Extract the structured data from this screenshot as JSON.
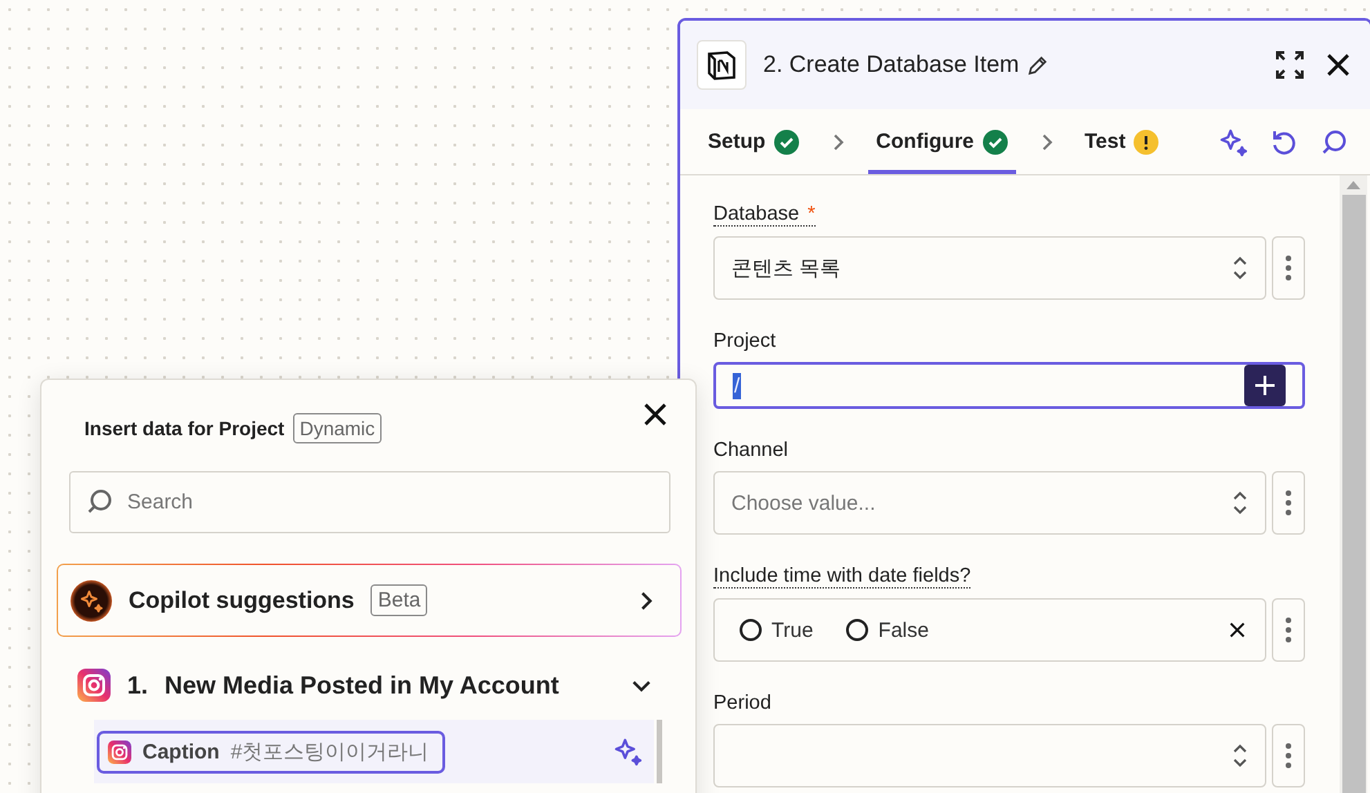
{
  "panel": {
    "title": "2. Create Database Item",
    "tabs": [
      {
        "label": "Setup",
        "selected": false,
        "complete": true
      },
      {
        "label": "Configure",
        "selected": true,
        "complete": true
      },
      {
        "label": "Test",
        "selected": false,
        "complete": false
      }
    ],
    "fields": [
      {
        "kind": "select",
        "label": "Database",
        "required_mark": "*",
        "hint": true,
        "value": "콘텐츠 목록"
      },
      {
        "kind": "input",
        "label": "Project",
        "hint": false,
        "value": "/",
        "focused": true
      },
      {
        "kind": "select",
        "label": "Channel",
        "hint": false,
        "placeholder": "Choose value..."
      },
      {
        "kind": "radio",
        "label": "Include time with date fields?",
        "hint": true,
        "options": [
          {
            "label": "True",
            "checked": false
          },
          {
            "label": "False",
            "checked": false
          }
        ]
      },
      {
        "kind": "select",
        "label": "Period",
        "hint": false
      }
    ]
  },
  "popup": {
    "title": "Insert data for Project",
    "badge": "Dynamic",
    "search": {
      "placeholder": "Search"
    },
    "copilot": {
      "label": "Copilot suggestions",
      "badge": "Beta"
    },
    "steps": [
      {
        "number": "1.",
        "title": "New Media Posted in My Account",
        "expanded": true,
        "items": [
          {
            "label": "Caption",
            "value": "#첫포스팅이이거라니",
            "selected": true
          }
        ]
      }
    ]
  }
}
